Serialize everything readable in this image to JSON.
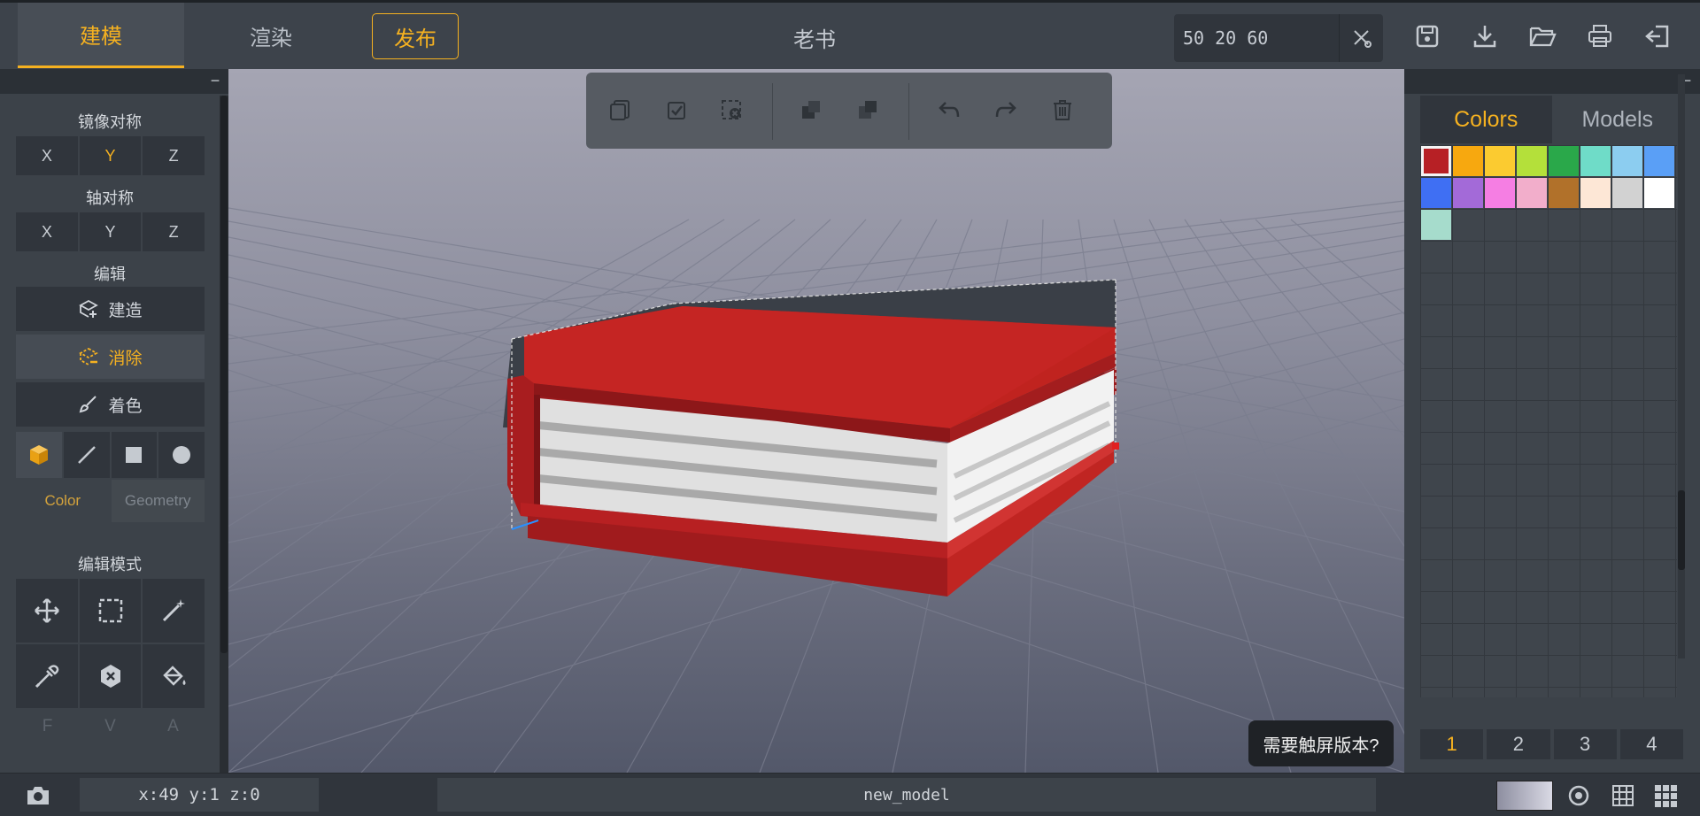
{
  "topbar": {
    "tabs": [
      {
        "label": "建模",
        "active": true
      },
      {
        "label": "渲染",
        "active": false
      },
      {
        "label": "发布",
        "active": false
      }
    ],
    "title": "老书",
    "dimensions": "50 20 60",
    "icons": [
      "scissors-icon",
      "save-icon",
      "download-icon",
      "folder-open-icon",
      "print-icon",
      "exit-icon"
    ]
  },
  "left_panel": {
    "mirror_title": "镜像对称",
    "mirror_axes": [
      "X",
      "Y",
      "Z"
    ],
    "mirror_active": "Y",
    "axis_title": "轴对称",
    "axis_axes": [
      "X",
      "Y",
      "Z"
    ],
    "edit_title": "编辑",
    "build_label": "建造",
    "erase_label": "消除",
    "paint_label": "着色",
    "subtab_color": "Color",
    "subtab_geometry": "Geometry",
    "edit_mode_title": "编辑模式",
    "fva": [
      "F",
      "V",
      "A"
    ]
  },
  "right_panel": {
    "tab_colors": "Colors",
    "tab_models": "Models",
    "colors": [
      "#b72025",
      "#f7a80f",
      "#fbcb30",
      "#b4e03a",
      "#2aa84a",
      "#6fdcc8",
      "#8ccdf0",
      "#5a9ff6",
      "#3f6ff3",
      "#a36ad8",
      "#f57ee3",
      "#f2aecb",
      "#b1712a",
      "#fde7d6",
      "#d2d2d2",
      "#ffffff",
      "#a6dccc"
    ],
    "selected_color_index": 0,
    "pages": [
      "1",
      "2",
      "3",
      "4"
    ],
    "active_page": "1"
  },
  "viewport": {
    "touch_prompt": "需要触屏版本?"
  },
  "bottombar": {
    "coords": "x:49  y:1  z:0",
    "model_name": "new_model"
  }
}
